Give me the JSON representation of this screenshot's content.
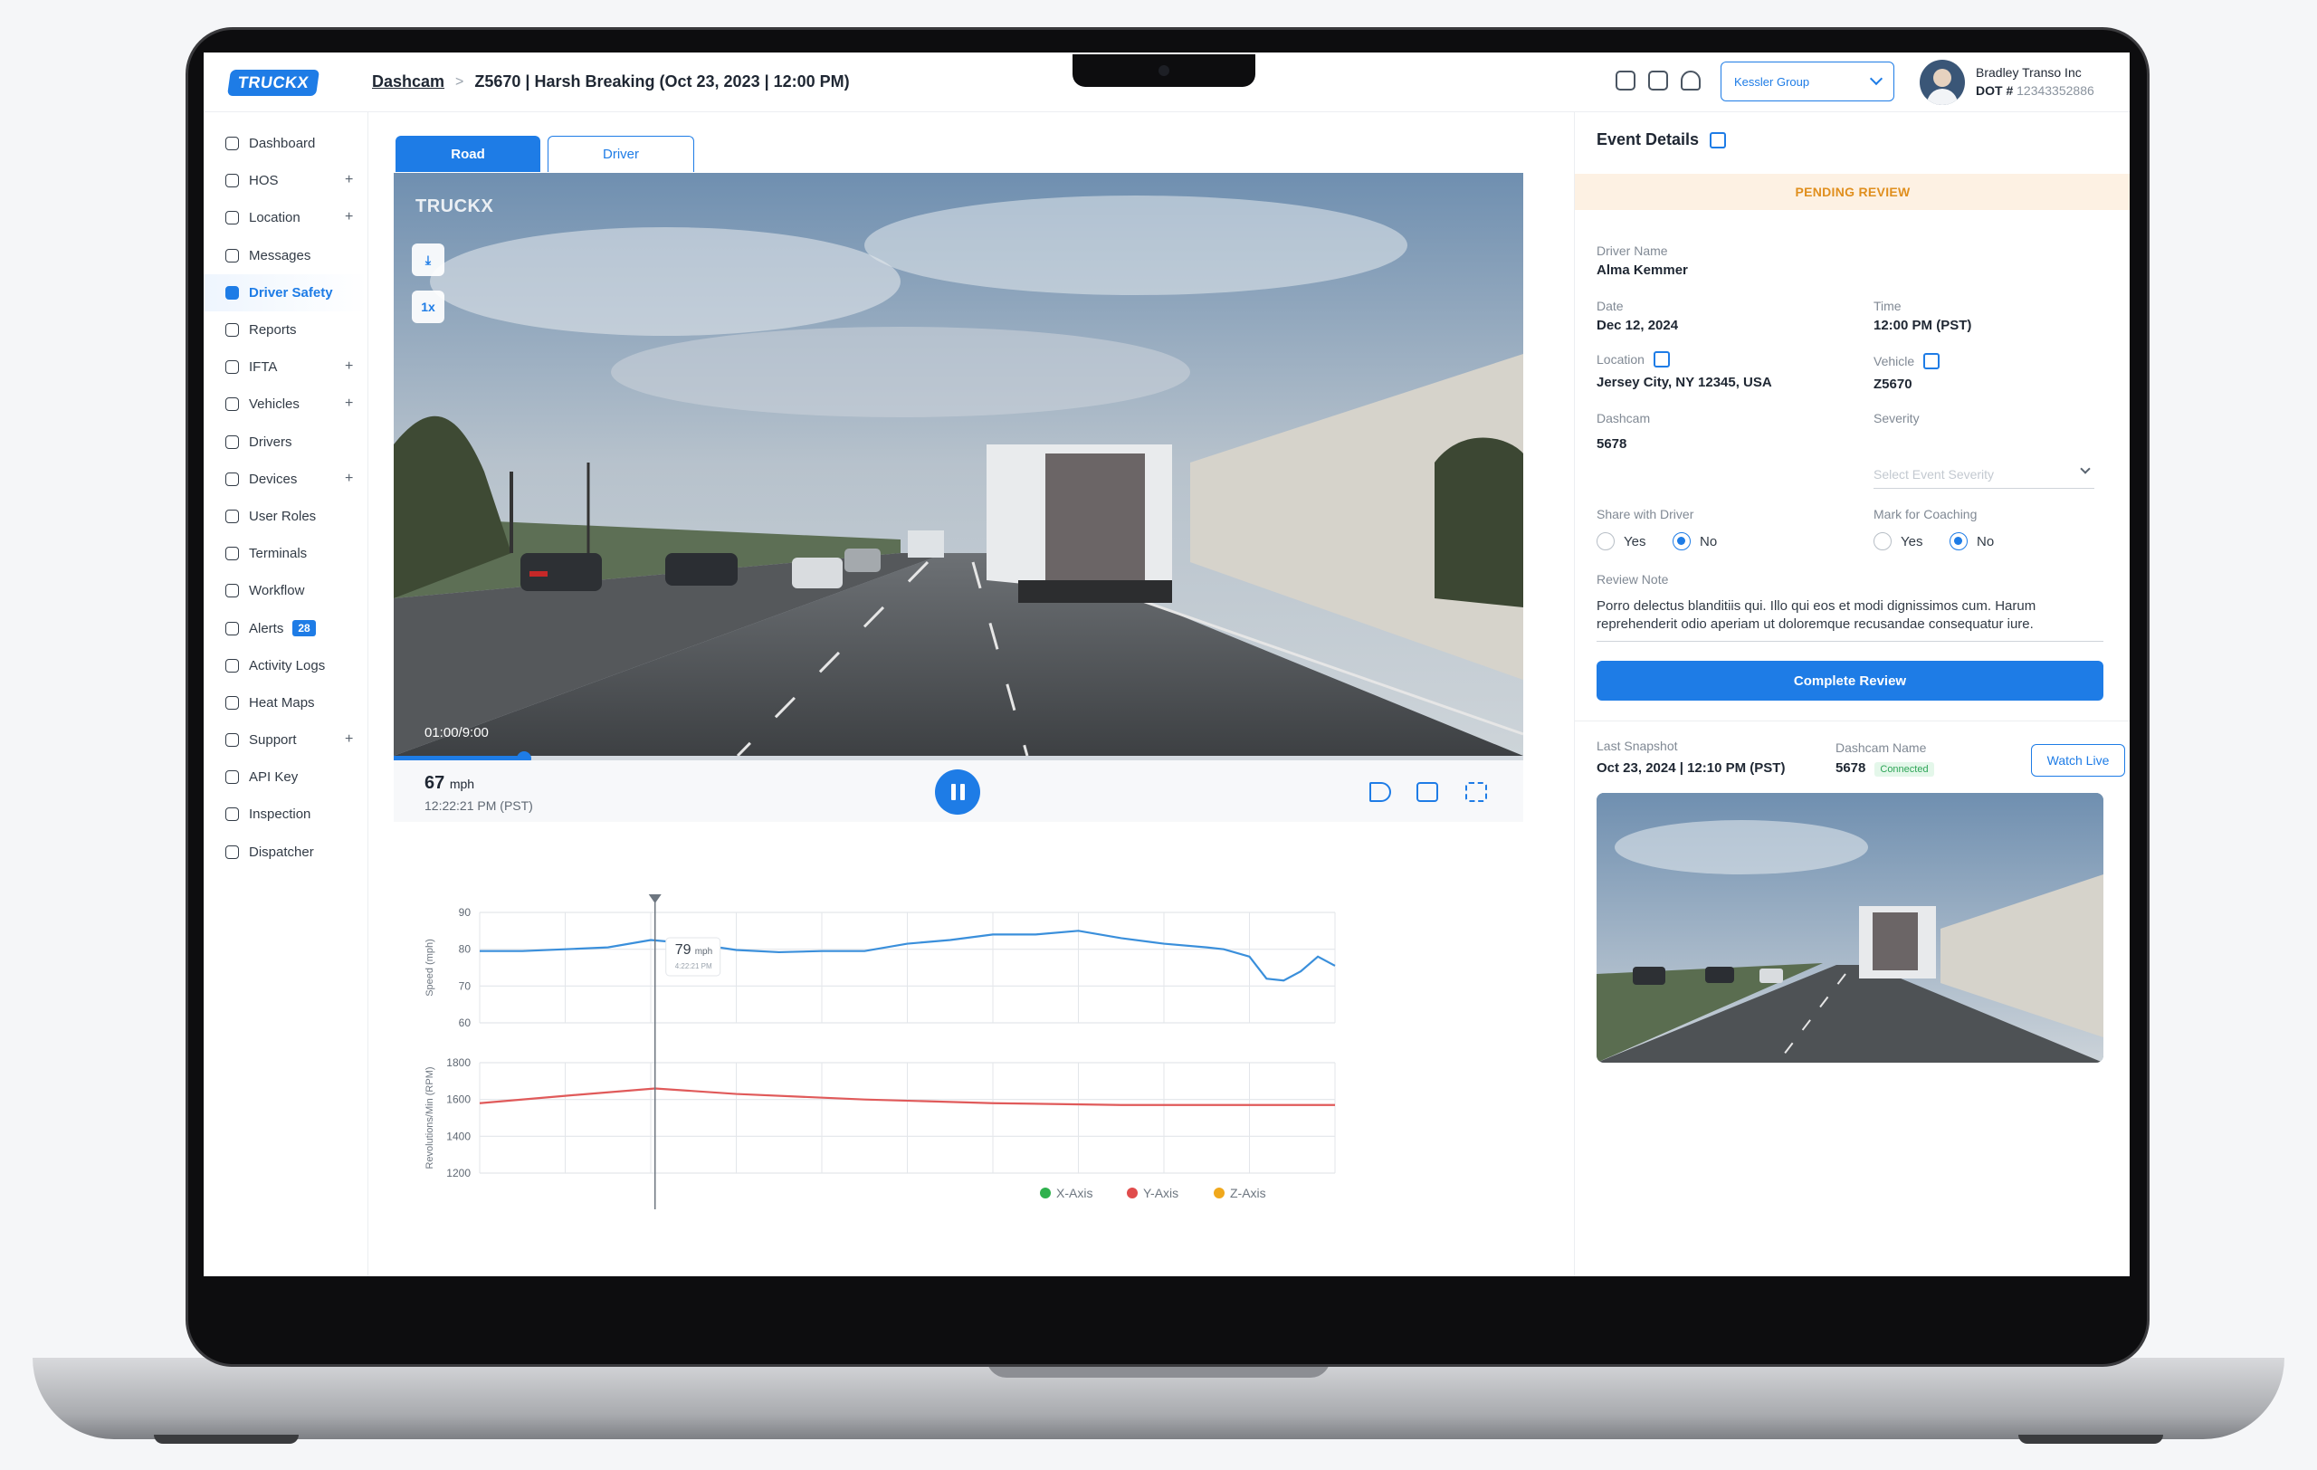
{
  "header": {
    "logo_text": "TRUCKX",
    "breadcrumb_root": "Dashcam",
    "breadcrumb_current": "Z5670 | Harsh Breaking (Oct 23, 2023 | 12:00 PM)",
    "company_select": "Kessler Group",
    "company_name": "Bradley Transo Inc",
    "dot_label": "DOT #",
    "dot_number": "12343352886"
  },
  "sidebar": {
    "items": [
      {
        "label": "Dashboard",
        "plus": ""
      },
      {
        "label": "HOS",
        "plus": "+"
      },
      {
        "label": "Location",
        "plus": "+"
      },
      {
        "label": "Messages",
        "plus": ""
      },
      {
        "label": "Driver Safety",
        "plus": ""
      },
      {
        "label": "Reports",
        "plus": ""
      },
      {
        "label": "IFTA",
        "plus": "+"
      },
      {
        "label": "Vehicles",
        "plus": "+"
      },
      {
        "label": "Drivers",
        "plus": ""
      },
      {
        "label": "Devices",
        "plus": "+"
      },
      {
        "label": "User Roles",
        "plus": ""
      },
      {
        "label": "Terminals",
        "plus": ""
      },
      {
        "label": "Workflow",
        "plus": ""
      },
      {
        "label": "Alerts",
        "plus": "",
        "badge": "28"
      },
      {
        "label": "Activity Logs",
        "plus": ""
      },
      {
        "label": "Heat Maps",
        "plus": ""
      },
      {
        "label": "Support",
        "plus": "+"
      },
      {
        "label": "API Key",
        "plus": ""
      },
      {
        "label": "Inspection",
        "plus": ""
      },
      {
        "label": "Dispatcher",
        "plus": ""
      }
    ]
  },
  "tabs": {
    "road": "Road",
    "driver": "Driver"
  },
  "video": {
    "logo": "TRUCKX",
    "speed_button": "1x",
    "time": "01:00/9:00",
    "progress": 0.115,
    "speed_value": "67",
    "speed_unit": "mph",
    "timestamp": "12:22:21 PM (PST)"
  },
  "chart_data": [
    {
      "type": "line",
      "ylabel": "Speed (mph)",
      "ylim": [
        60,
        90
      ],
      "yticks": [
        90,
        80,
        70,
        60
      ],
      "x": [
        0,
        0.05,
        0.1,
        0.15,
        0.2,
        0.25,
        0.3,
        0.35,
        0.4,
        0.45,
        0.5,
        0.55,
        0.6,
        0.65,
        0.7,
        0.75,
        0.8,
        0.85,
        0.87,
        0.9,
        0.92,
        0.94,
        0.96,
        0.98,
        1.0
      ],
      "series": [
        {
          "values": [
            79.5,
            79.5,
            80,
            80.5,
            82.5,
            81.5,
            79.8,
            79.2,
            79.5,
            79.5,
            81.5,
            82.5,
            84,
            84,
            85,
            83,
            81.5,
            80.5,
            80,
            78,
            72,
            71.5,
            74,
            78,
            75.5
          ],
          "color": "#3a8fdb"
        }
      ],
      "marker_x": 0.205,
      "tooltip_value": "79",
      "tooltip_unit": "mph",
      "tooltip_time": "4:22:21 PM",
      "grid": true
    },
    {
      "type": "line",
      "ylabel": "Revolutions/Min (RPM)",
      "ylim": [
        1200,
        1800
      ],
      "yticks": [
        1800,
        1600,
        1400,
        1200
      ],
      "x": [
        0,
        0.1,
        0.205,
        0.3,
        0.45,
        0.6,
        0.75,
        0.9,
        1.0
      ],
      "series": [
        {
          "values": [
            1580,
            1620,
            1660,
            1630,
            1600,
            1580,
            1570,
            1570,
            1570
          ],
          "color": "#e05a5a"
        }
      ],
      "legend": [
        {
          "name": "X-Axis",
          "color": "#2fb14d"
        },
        {
          "name": "Y-Axis",
          "color": "#e04c4c"
        },
        {
          "name": "Z-Axis",
          "color": "#f0a81c"
        }
      ],
      "grid": true
    }
  ],
  "event_details": {
    "title": "Event Details",
    "status": "PENDING REVIEW",
    "driver_name_label": "Driver Name",
    "driver_name": "Alma Kemmer",
    "date_label": "Date",
    "date": "Dec 12, 2024",
    "time_label": "Time",
    "time": "12:00 PM (PST)",
    "location_label": "Location",
    "location": "Jersey City, NY 12345, USA",
    "vehicle_label": "Vehicle",
    "vehicle": "Z5670",
    "dashcam_label": "Dashcam",
    "dashcam": "5678",
    "severity_label": "Severity",
    "severity_placeholder": "Select Event Severity",
    "share_label": "Share with Driver",
    "coaching_label": "Mark for Coaching",
    "yes": "Yes",
    "no": "No",
    "review_note_label": "Review Note",
    "review_note": "Porro delectus blanditiis qui. Illo qui eos et modi dignissimos cum. Harum reprehenderit odio aperiam ut doloremque recusandae consequatur iure.",
    "complete_button": "Complete Review"
  },
  "snapshot": {
    "last_label": "Last Snapshot",
    "last_value": "Oct 23, 2024 | 12:10 PM (PST)",
    "dashcam_name_label": "Dashcam Name",
    "dashcam_name": "5678",
    "connected": "Connected",
    "watch_button": "Watch Live"
  }
}
